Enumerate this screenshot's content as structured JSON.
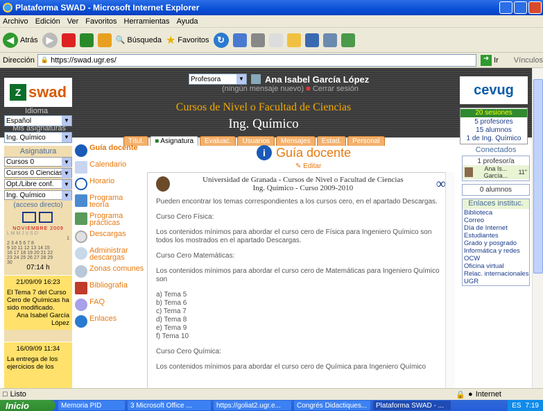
{
  "window": {
    "title": "Plataforma SWAD - Microsoft Internet Explorer"
  },
  "menubar": [
    "Archivo",
    "Edición",
    "Ver",
    "Favoritos",
    "Herramientas",
    "Ayuda"
  ],
  "toolbar": {
    "back": "Atrás",
    "search": "Búsqueda",
    "favorites": "Favoritos"
  },
  "address": {
    "label": "Dirección",
    "url": "https://swad.ugr.es/",
    "go": "Ir",
    "links": "Vínculos"
  },
  "header": {
    "logo": "swad",
    "role": "Profesora",
    "user_name": "Ana Isabel García López",
    "no_message": "(ningún mensaje nuevo)",
    "logout": "Cerrar sesión",
    "lang_label": "Idioma",
    "lang_value": "Español",
    "subjects_label": "Mis asignaturas",
    "subjects_value": "Ing. Químico",
    "course_line1": "Cursos de Nivel o Facultad de Ciencias",
    "course_line2": "Ing. Químico",
    "cevug": "cevug",
    "sessions_title": "20 sesiones",
    "sessions_prof": "5 profesores",
    "sessions_students": "15 alumnos",
    "sessions_of": "1 de Ing. Químico"
  },
  "tabs": [
    "Títul.",
    "Asignatura",
    "Evaluac.",
    "Usuarios",
    "Mensajes",
    "Estad.",
    "Personal"
  ],
  "left": {
    "title": "Asignatura",
    "selects": [
      "Cursos 0",
      "Cursos 0 Ciencias",
      "Opt./Libre conf.",
      "Ing. Químico"
    ],
    "direct": "(acceso directo)",
    "cal_head": "NOVIEMBRE 2009",
    "cal_days": "L M M J V S D",
    "cal_rows": [
      "1",
      "2 3 4 5 6 7 8",
      "9 10 11 12 13 14 15",
      "16 17 18 19 20 21 22",
      "23 24 25 26 27 28 29",
      "30"
    ],
    "time": "07:14 h",
    "notice1": {
      "date": "21/09/09 16:23",
      "text": "El Tema 7 del Curso Cero de Químicas ha sido modificado.",
      "author": "Ana Isabel García López"
    },
    "notice2": {
      "date": "16/09/09 11:34",
      "text": "La entrega de los ejercicios de los"
    }
  },
  "menu": [
    "Guía docente",
    "Calendario",
    "Horario",
    "Programa teoría",
    "Programa prácticas",
    "Descargas",
    "Administrar descargas",
    "Zonas comunes",
    "Bibliografía",
    "FAQ",
    "Enlaces"
  ],
  "main": {
    "title": "Guía docente",
    "edit": "Editar",
    "doc_head1": "Universidad de Granada - Cursos de Nivel o Facultad de Ciencias",
    "doc_head2": "Ing. Químico - Curso 2009-2010",
    "p1": "Pueden encontrar los temas correspondientes a los cursos cero, en el apartado Descargas.",
    "p2": "Curso Cero Física:",
    "p3": "Los contenidos mínimos para abordar el curso cero de Física para Ingeniero Químico son todos los mostrados en el apartado Descargas.",
    "p4": "Curso Cero Matemáticas:",
    "p5": "Los contenidos mínimos para abordar el curso cero de Matemáticas para Ingeniero Químico son",
    "list": [
      "a) Tema 5",
      "b) Tema 6",
      "c) Tema 7",
      "d) Tema 8",
      "e) Tema 9",
      "f) Tema 10"
    ],
    "p6": "Curso Cero Química:",
    "p7": "Los contenidos mínimos para abordar el curso cero de Química para Ingeniero Químico"
  },
  "right": {
    "title": "Conectados",
    "prof": "1 profesor/a",
    "user": "Ana Is... García...",
    "user_time": "11\"",
    "students": "0 alumnos",
    "links_title": "Enlaces instituc.",
    "links": [
      "Biblioteca",
      "Correo",
      "Día de Internet",
      "Estudiantes",
      "Grado y posgrado",
      "Informática y redes",
      "OCW",
      "Oficina virtual",
      "Relac. internacionales",
      "UGR"
    ]
  },
  "status": {
    "text": "Listo",
    "zone": "Internet"
  },
  "taskbar": {
    "start": "Inicio",
    "items": [
      "Memoria PID",
      "3 Microsoft Office ...",
      "https://goliat2.ugr.e...",
      "Congrés Didactiques...",
      "Plataforma SWAD - ..."
    ],
    "lang": "ES",
    "clock": "7:19"
  }
}
